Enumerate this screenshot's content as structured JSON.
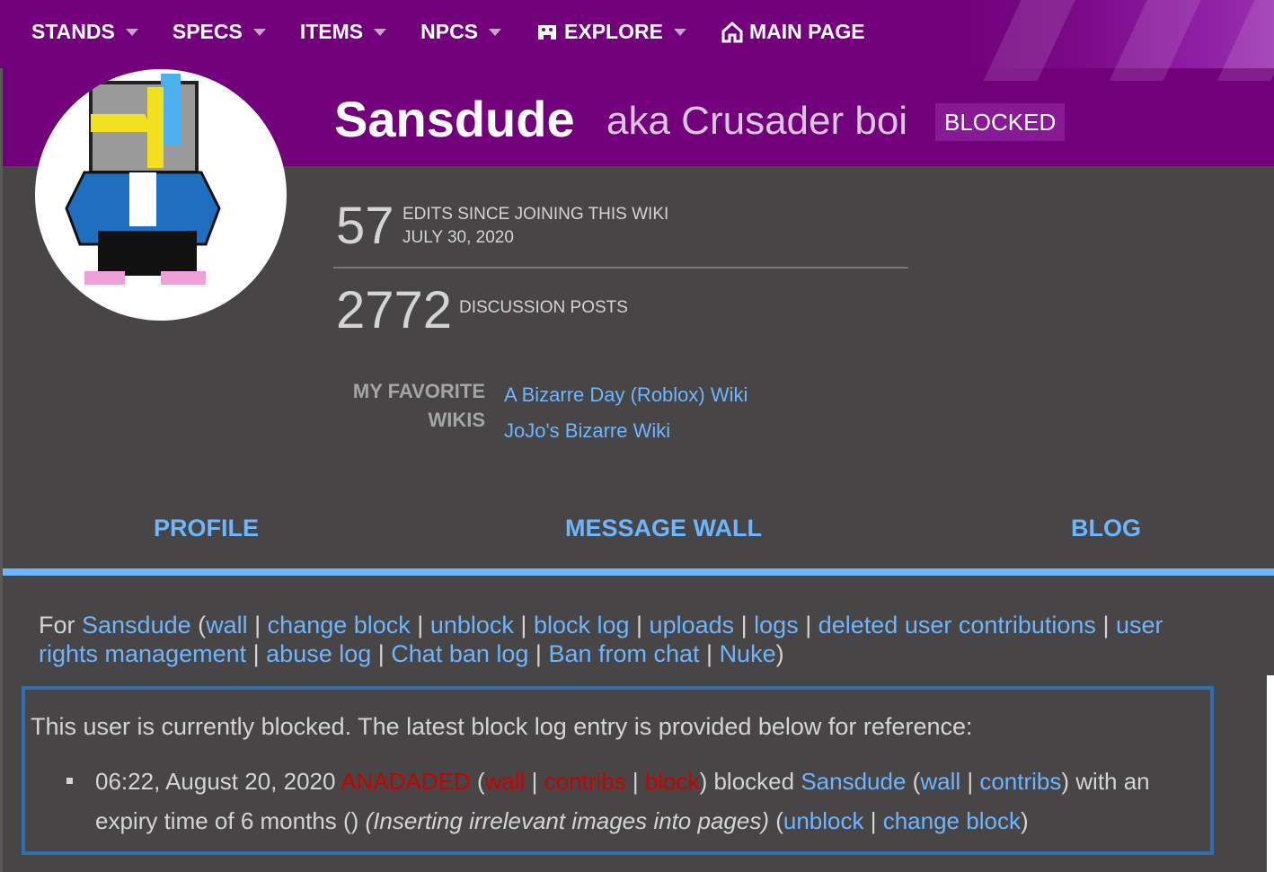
{
  "nav": {
    "items": [
      {
        "label": "STANDS"
      },
      {
        "label": "SPECS"
      },
      {
        "label": "ITEMS"
      },
      {
        "label": "NPCS"
      },
      {
        "label": "EXPLORE",
        "icon": "gamepad-icon"
      },
      {
        "label": "MAIN PAGE",
        "icon": "home-icon"
      }
    ]
  },
  "profile": {
    "name": "Sansdude",
    "aka": "aka Crusader boi",
    "badge": "BLOCKED",
    "edits": "57",
    "edits_label": "EDITS SINCE JOINING THIS WIKI",
    "joined": "JULY 30, 2020",
    "posts": "2772",
    "posts_label": "DISCUSSION POSTS",
    "fav_label_1": "MY FAVORITE",
    "fav_label_2": "WIKIS",
    "favs": [
      "A Bizarre Day (Roblox) Wiki",
      "JoJo's Bizarre Wiki"
    ]
  },
  "tabs": [
    "PROFILE",
    "MESSAGE WALL",
    "BLOG"
  ],
  "tools": {
    "prefix": "For ",
    "user": "Sansdude",
    "links": [
      "wall",
      "change block",
      "unblock",
      "block log",
      "uploads",
      "logs",
      "deleted user contributions",
      "user rights management",
      "abuse log",
      "Chat ban log",
      "Ban from chat",
      "Nuke"
    ]
  },
  "block": {
    "notice": "This user is currently blocked. The latest block log entry is provided below for reference:",
    "time": "06:22, August 20, 2020",
    "admin": "ANADADED",
    "admin_links": [
      "wall",
      "contribs",
      "block"
    ],
    "action": "blocked",
    "user": "Sansdude",
    "user_links": [
      "wall",
      "contribs"
    ],
    "expiry": "with an expiry time of 6 months ()",
    "reason": "(Inserting irrelevant images into pages)",
    "entry_links": [
      "unblock",
      "change block"
    ]
  },
  "colors": {
    "header": "#71007a",
    "link": "#6db6ff",
    "background": "#474545",
    "box_border": "#2f6fb0",
    "redlink": "#cc0000"
  }
}
